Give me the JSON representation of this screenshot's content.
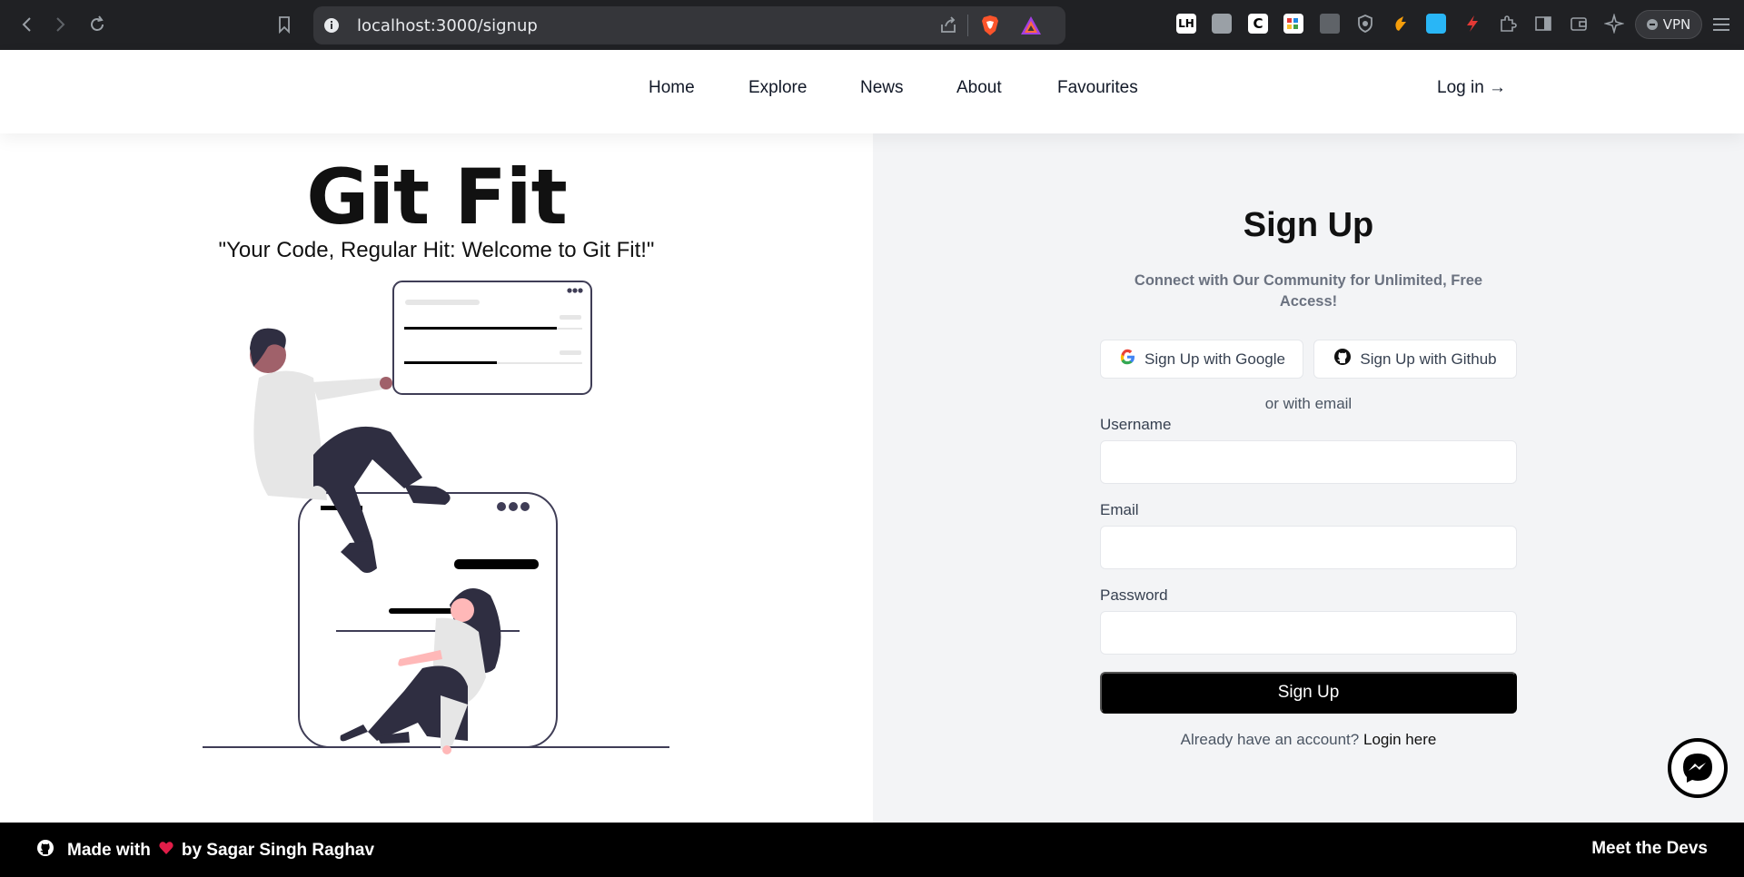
{
  "browser": {
    "url": "localhost:3000/signup",
    "vpn_label": "VPN",
    "extensions": [
      "brave-shield-icon",
      "brave-rewards-icon",
      "lighthouse-icon",
      "ext-grey-icon",
      "ext-c-icon",
      "ext-color-icon",
      "ext-window-icon",
      "ext-shield-icon",
      "ext-orange-icon",
      "ext-blue-icon",
      "ext-red-icon",
      "puzzle-icon",
      "sidebar-icon",
      "wallet-icon",
      "leo-icon"
    ]
  },
  "header": {
    "menu": [
      "Home",
      "Explore",
      "News",
      "About",
      "Favourites"
    ],
    "login": "Log in →"
  },
  "hero": {
    "title": "Git Fit",
    "tagline": "\"Your Code, Regular Hit: Welcome to Git Fit!\""
  },
  "signup": {
    "title": "Sign Up",
    "subtitle": "Connect with Our Community for Unlimited, Free Access!",
    "google_label": "Sign Up with Google",
    "github_label": "Sign Up with Github",
    "or_email": "or with email",
    "username_label": "Username",
    "email_label": "Email",
    "password_label": "Password",
    "submit_label": "Sign Up",
    "already_text": "Already have an account?",
    "login_link": "Login here"
  },
  "footer": {
    "made_with": "Made with",
    "by": "by Sagar Singh Raghav",
    "meet": "Meet the Devs"
  },
  "colors": {
    "accent": "#000000",
    "right_bg": "#f3f4f6",
    "heart": "#e11d48"
  }
}
